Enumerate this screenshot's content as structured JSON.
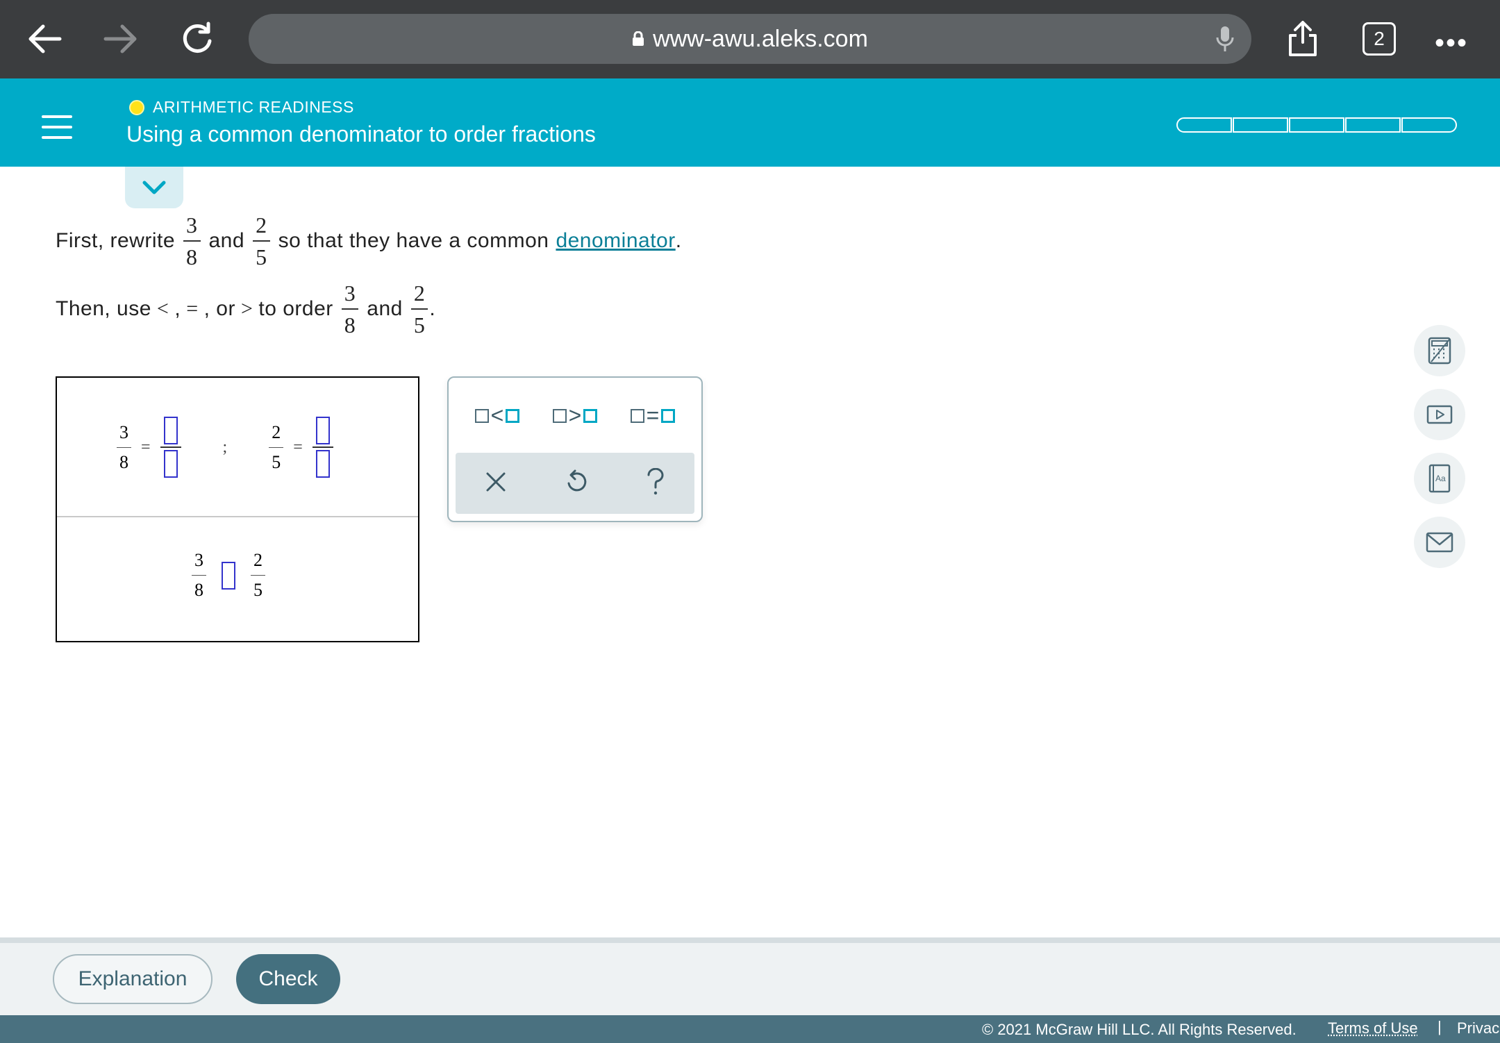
{
  "browser": {
    "url": "www-awu.aleks.com",
    "tab_count": "2",
    "more": "•••"
  },
  "header": {
    "topic": "ARITHMETIC READINESS",
    "title": "Using a common denominator to order fractions",
    "progress_segments": 5,
    "progress_filled": 0
  },
  "problem": {
    "line1": {
      "prefix": "First, rewrite",
      "frac1_num": "3",
      "frac1_den": "8",
      "and": "and",
      "frac2_num": "2",
      "frac2_den": "5",
      "middle": "so that they have a common",
      "link": "denominator",
      "end": "."
    },
    "line2": {
      "prefix": "Then, use",
      "lt": "<",
      "comma1": ",",
      "eq": "=",
      "comma2": ", or",
      "gt": ">",
      "middle": "to order",
      "frac1_num": "3",
      "frac1_den": "8",
      "and": "and",
      "frac2_num": "2",
      "frac2_den": "5",
      "end": "."
    }
  },
  "answer": {
    "f1_num": "3",
    "f1_den": "8",
    "eq1": "=",
    "semicolon": ";",
    "f2_num": "2",
    "f2_den": "5",
    "eq2": "=",
    "c1_num": "3",
    "c1_den": "8",
    "c2_num": "2",
    "c2_den": "5"
  },
  "keypad": {
    "lt": "<",
    "gt": ">",
    "eq": "="
  },
  "footer": {
    "explanation": "Explanation",
    "check": "Check",
    "copyright": "© 2021 McGraw Hill LLC. All Rights Reserved.",
    "terms": "Terms of Use",
    "separator": "|",
    "privacy": "Privac"
  },
  "colors": {
    "header": "#00abc8",
    "accent_teal": "#00a7c4",
    "check_button": "#44707f",
    "blank_box": "#3333cc"
  }
}
